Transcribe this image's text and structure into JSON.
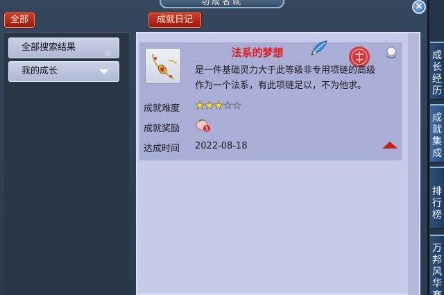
{
  "window": {
    "title": "功成名就"
  },
  "buttons": {
    "all_label": "全部",
    "diary_label": "成就日记"
  },
  "sidebar": {
    "items": [
      {
        "label": "全部搜索结果"
      },
      {
        "label": "我的成长"
      }
    ]
  },
  "achievement": {
    "title": "法系的梦想",
    "description": "是一件基础灵力大于此等级非专用项链的高级作为一个法系，有此项链足以，不为他求。",
    "description_line1": "是一件基础灵力大于此等级非专用项链的高级",
    "description_line2": "作为一个法系，有此项链足以，不为他求。",
    "difficulty_label": "成就难度",
    "difficulty_stars": 3,
    "difficulty_max": 5,
    "reward_label": "成就奖励",
    "reward_badge": "1",
    "date_label": "达成时间",
    "date_value": "2022-08-18"
  },
  "side_tabs": [
    {
      "chars": [
        "成",
        "长",
        "经",
        "历"
      ]
    },
    {
      "chars": [
        "成",
        "就",
        "集",
        "成"
      ]
    },
    {
      "chars": [
        "排",
        "行",
        "榜"
      ]
    },
    {
      "chars": [
        "万",
        "邦",
        "风",
        "华",
        "赛"
      ]
    }
  ],
  "colors": {
    "title_red": "#e31a1a",
    "star_gold": "#f7e032",
    "panel_lavender": "#c6cbea",
    "button_red": "#b8281c"
  },
  "icons": {
    "item": "necklace-icon",
    "feather": "feather-icon",
    "stamp": "seal-stamp-icon",
    "pearl": "pearl-icon",
    "reward": "peach-icon",
    "close": "close-icon",
    "collapse": "collapse-arrow-icon"
  }
}
